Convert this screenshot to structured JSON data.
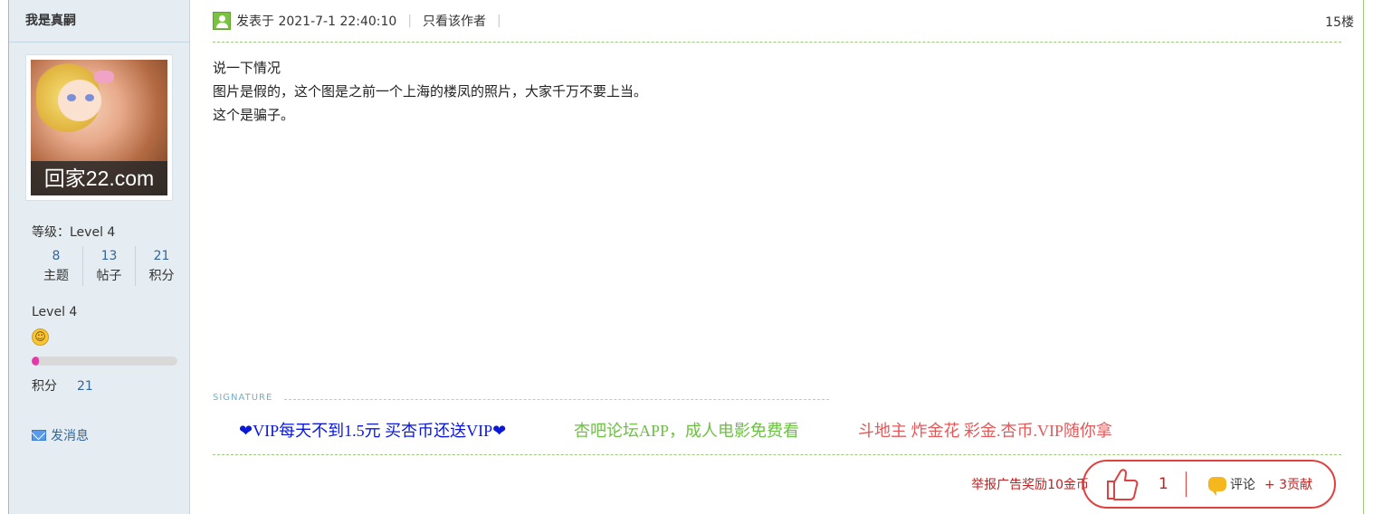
{
  "user": {
    "name": "我是真嗣",
    "avatar_watermark": "回家22.com",
    "level_label": "等级：Level 4",
    "stats": [
      {
        "value": "8",
        "label": "主题"
      },
      {
        "value": "13",
        "label": "帖子"
      },
      {
        "value": "21",
        "label": "积分"
      }
    ],
    "level_name": "Level 4",
    "progress_fraction": 0.05,
    "points_label": "积分",
    "points_value": "21",
    "send_message": "发消息",
    "icons": {
      "mail": "mail-icon",
      "smiley": "smiley-icon"
    }
  },
  "post": {
    "posted_at": "发表于 2021-7-1 22:40:10",
    "author_only": "只看该作者",
    "floor": "15楼",
    "body_lines": [
      "说一下情况",
      "图片是假的，这个图是之前一个上海的楼凤的照片，大家千万不要上当。",
      "这个是骗子。"
    ]
  },
  "signature": {
    "label": "SIGNATURE",
    "links": [
      {
        "text": "❤VIP每天不到1.5元 买杏币还送VIP❤",
        "color": "#0a17d6"
      },
      {
        "text": "杏吧论坛APP，成人电影免费看",
        "color": "#6bc141"
      },
      {
        "text": "斗地主 炸金花 彩金.杏币.VIP随你拿",
        "color": "#e05a5a"
      }
    ]
  },
  "footer": {
    "report": "举报广告奖励10金币",
    "like_count": "1",
    "comment": "评论",
    "contribution": "+ 3贡献"
  },
  "colors": {
    "accent_green": "#9cc97a",
    "sidebar_bg": "#e5edf2",
    "link_blue": "#336699",
    "red": "#c02020"
  }
}
